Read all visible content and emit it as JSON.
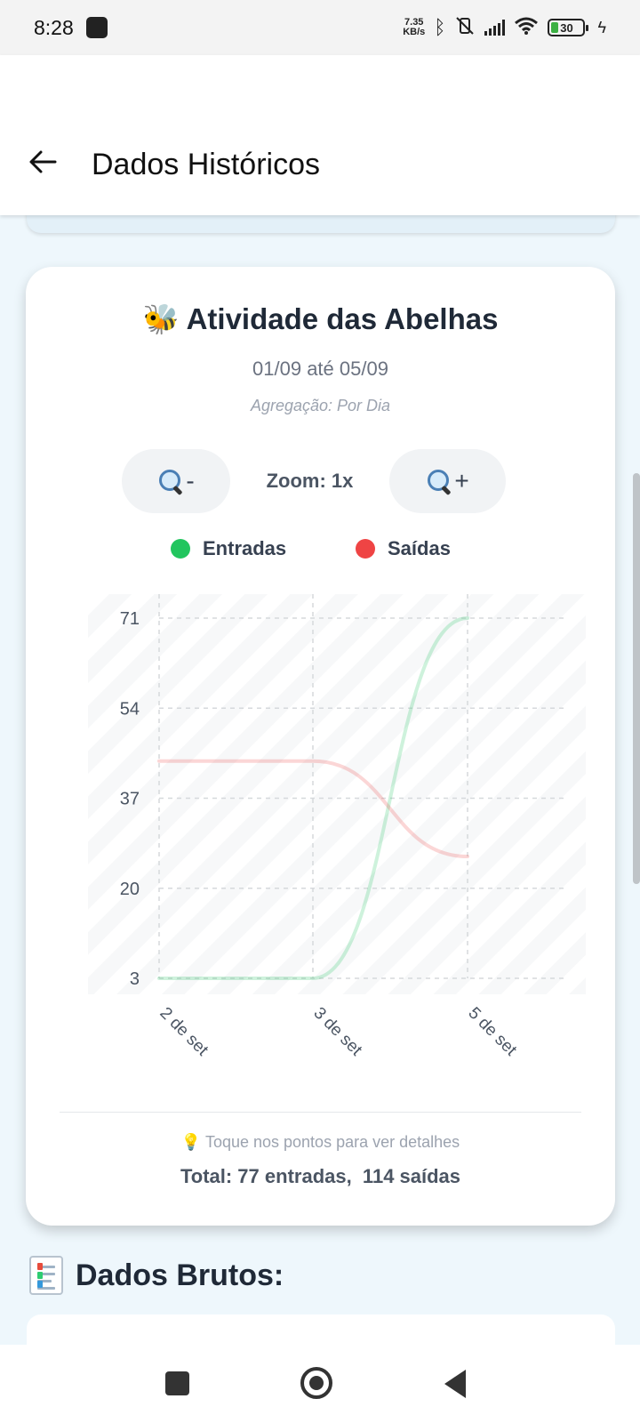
{
  "status_bar": {
    "time": "8:28",
    "net_speed_value": "7.35",
    "net_speed_unit": "KB/s",
    "battery": "30",
    "icons": [
      "bluetooth-icon",
      "vibrate-off-icon",
      "signal-icon",
      "wifi-icon",
      "battery-icon",
      "charging-icon"
    ]
  },
  "app_bar": {
    "back_icon": "arrow-left-icon",
    "title": "Dados Históricos"
  },
  "card": {
    "title": "Atividade das Abelhas",
    "title_icon": "bee-icon",
    "date_range": "01/09 até 05/09",
    "aggregation": "Agregação: Por Dia",
    "zoom": {
      "zoom_out_label": "-",
      "zoom_in_label": "+",
      "zoom_text": "Zoom: 1x"
    },
    "hint_icon": "lightbulb-icon",
    "hint": "Toque nos pontos para ver detalhes",
    "totals": "Total: 77 entradas,  114 saídas"
  },
  "chart_data": {
    "type": "line",
    "categories": [
      "2 de set",
      "3 de set",
      "5 de set"
    ],
    "series": [
      {
        "name": "Entradas",
        "color": "#22c55e",
        "values": [
          3,
          3,
          71
        ]
      },
      {
        "name": "Saídas",
        "color": "#ef4444",
        "values": [
          44,
          44,
          26
        ]
      }
    ],
    "yticks": [
      71,
      54,
      37,
      20,
      3
    ],
    "ylim": [
      3,
      71
    ],
    "grid": true,
    "legend": "top"
  },
  "sections": {
    "raw_data_title": "Dados Brutos:",
    "raw_data_icon": "document-icon"
  },
  "nav_bar": {
    "icons": [
      "recents-icon",
      "home-icon",
      "back-icon"
    ]
  }
}
